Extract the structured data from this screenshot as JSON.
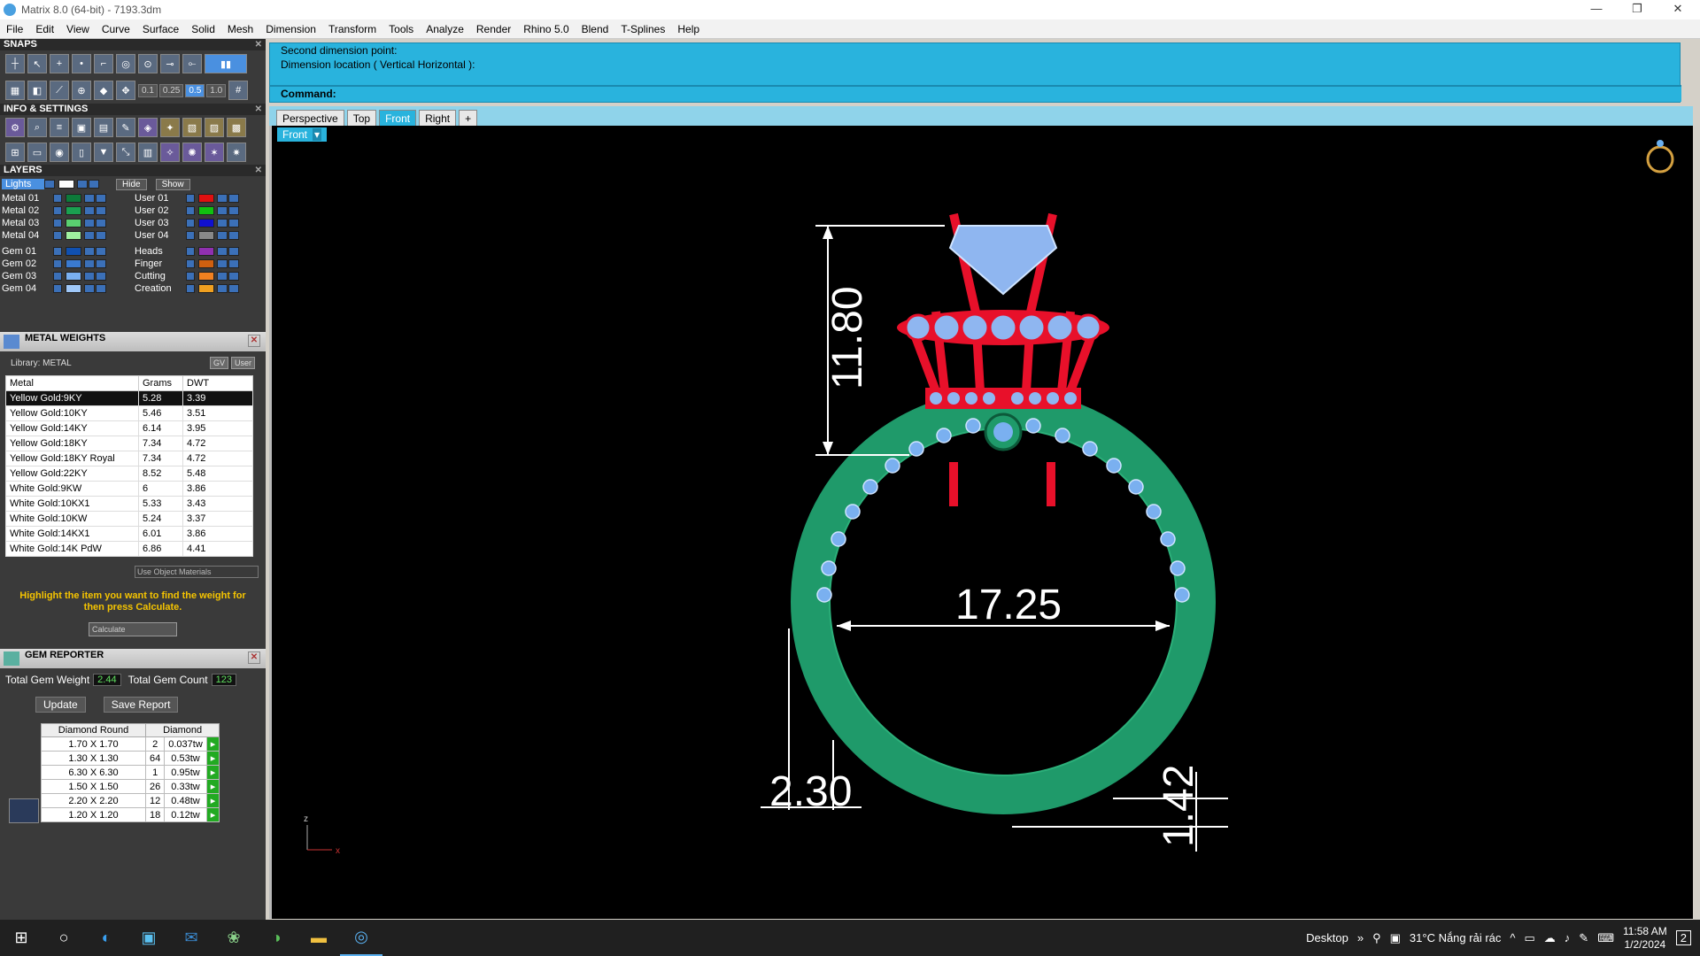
{
  "window": {
    "title": "Matrix 8.0 (64-bit) - 7193.3dm",
    "min": "—",
    "max": "❐",
    "close": "✕"
  },
  "menu": [
    "File",
    "Edit",
    "View",
    "Curve",
    "Surface",
    "Solid",
    "Mesh",
    "Dimension",
    "Transform",
    "Tools",
    "Analyze",
    "Render",
    "Rhino 5.0",
    "Blend",
    "T-Splines",
    "Help"
  ],
  "snaps": {
    "title": "SNAPS",
    "nums": [
      "0.1",
      "0.25",
      "0.5",
      "1.0"
    ]
  },
  "info": {
    "title": "INFO & SETTINGS"
  },
  "layers": {
    "title": "LAYERS",
    "lights": "Lights",
    "hide": "Hide",
    "show": "Show",
    "left": [
      {
        "name": "Metal 01",
        "color": "#0d7a3a"
      },
      {
        "name": "Metal 02",
        "color": "#1aa050"
      },
      {
        "name": "Metal 03",
        "color": "#5ad070"
      },
      {
        "name": "Metal 04",
        "color": "#a0f0a0"
      },
      {
        "name": "Gem 01",
        "color": "#1050b0"
      },
      {
        "name": "Gem 02",
        "color": "#3a7ad0"
      },
      {
        "name": "Gem 03",
        "color": "#7ab0f0"
      },
      {
        "name": "Gem 04",
        "color": "#a0c8f8"
      }
    ],
    "right": [
      {
        "name": "User 01",
        "color": "#e01010"
      },
      {
        "name": "User 02",
        "color": "#10c010"
      },
      {
        "name": "User 03",
        "color": "#1010d0"
      },
      {
        "name": "User 04",
        "color": "#888888"
      },
      {
        "name": "Heads",
        "color": "#9030b0"
      },
      {
        "name": "Finger",
        "color": "#d06010"
      },
      {
        "name": "Cutting",
        "color": "#f08020"
      },
      {
        "name": "Creation",
        "color": "#f0a020"
      }
    ]
  },
  "metal_weights": {
    "title": "METAL WEIGHTS",
    "library": "Library: METAL",
    "gv": "GV",
    "user": "User",
    "headers": [
      "Metal",
      "Grams",
      "DWT"
    ],
    "rows": [
      [
        "Yellow Gold:9KY",
        "5.28",
        "3.39"
      ],
      [
        "Yellow Gold:10KY",
        "5.46",
        "3.51"
      ],
      [
        "Yellow Gold:14KY",
        "6.14",
        "3.95"
      ],
      [
        "Yellow Gold:18KY",
        "7.34",
        "4.72"
      ],
      [
        "Yellow Gold:18KY Royal",
        "7.34",
        "4.72"
      ],
      [
        "Yellow Gold:22KY",
        "8.52",
        "5.48"
      ],
      [
        "White Gold:9KW",
        "6",
        "3.86"
      ],
      [
        "White Gold:10KX1",
        "5.33",
        "3.43"
      ],
      [
        "White Gold:10KW",
        "5.24",
        "3.37"
      ],
      [
        "White Gold:14KX1",
        "6.01",
        "3.86"
      ],
      [
        "White Gold:14K PdW",
        "6.86",
        "4.41"
      ]
    ],
    "use_object": "Use Object Materials",
    "hint": "Highlight the item you want to find the weight for then press Calculate.",
    "calculate": "Calculate"
  },
  "gem_reporter": {
    "title": "GEM REPORTER",
    "weight_label": "Total Gem Weight",
    "weight": "2.44",
    "count_label": "Total Gem Count",
    "count": "123",
    "update": "Update",
    "save": "Save Report",
    "headers": [
      "Diamond Round",
      "Diamond"
    ],
    "rows": [
      [
        "1.70 X 1.70",
        "2",
        "0.037tw"
      ],
      [
        "1.30 X 1.30",
        "64",
        "0.53tw"
      ],
      [
        "6.30 X 6.30",
        "1",
        "0.95tw"
      ],
      [
        "1.50 X 1.50",
        "26",
        "0.33tw"
      ],
      [
        "2.20 X 2.20",
        "12",
        "0.48tw"
      ],
      [
        "1.20 X 1.20",
        "18",
        "0.12tw"
      ]
    ]
  },
  "command": {
    "line1": "Second dimension point:",
    "line2": "Dimension location ( Vertical  Horizontal ):",
    "label": "Command:"
  },
  "tabs": [
    "Perspective",
    "Top",
    "Front",
    "Right",
    "+"
  ],
  "viewport": {
    "label": "Front",
    "dims": [
      "11.80",
      "17.25",
      "2.30",
      "1.42"
    ],
    "axis_z": "z",
    "axis_x": "x"
  },
  "taskbar": {
    "desktop": "Desktop",
    "weather": "31°C  Nắng rải rác",
    "time": "11:58 AM",
    "date": "1/2/2024",
    "notif": "2"
  }
}
